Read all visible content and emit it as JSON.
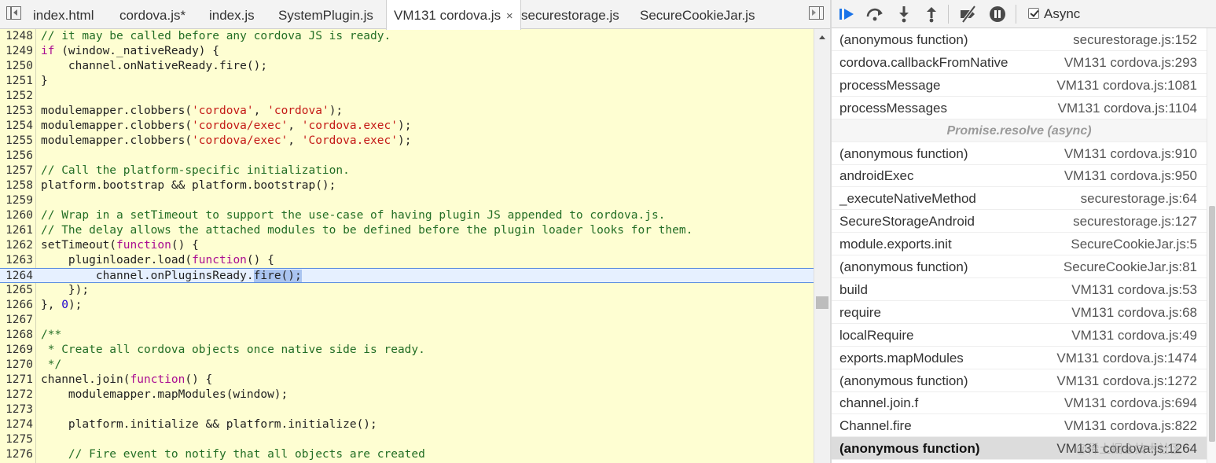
{
  "tabs": [
    {
      "label": "index.html",
      "active": false
    },
    {
      "label": "cordova.js*",
      "active": false
    },
    {
      "label": "index.js",
      "active": false
    },
    {
      "label": "SystemPlugin.js",
      "active": false
    },
    {
      "label": "VM131 cordova.js",
      "active": true,
      "close": "×"
    },
    {
      "label": "securestorage.js",
      "active": false
    },
    {
      "label": "SecureCookieJar.js",
      "active": false
    }
  ],
  "icons": {
    "toggle_navigator": "toggle-navigator-icon",
    "toggle_debugger": "toggle-debugger-icon"
  },
  "code": {
    "execution_line": "1264",
    "lines": [
      {
        "num": "1248",
        "tokens": [
          {
            "t": "// it may be called before any cordova JS is ready.",
            "c": "c"
          }
        ]
      },
      {
        "num": "1249",
        "tokens": [
          {
            "t": "if",
            "c": "k"
          },
          {
            "t": " (window._nativeReady) {"
          }
        ]
      },
      {
        "num": "1250",
        "tokens": [
          {
            "t": "    channel.onNativeReady.fire();"
          }
        ]
      },
      {
        "num": "1251",
        "tokens": [
          {
            "t": "}"
          }
        ]
      },
      {
        "num": "1252",
        "tokens": []
      },
      {
        "num": "1253",
        "tokens": [
          {
            "t": "modulemapper.clobbers("
          },
          {
            "t": "'cordova'",
            "c": "s"
          },
          {
            "t": ", "
          },
          {
            "t": "'cordova'",
            "c": "s"
          },
          {
            "t": ");"
          }
        ]
      },
      {
        "num": "1254",
        "tokens": [
          {
            "t": "modulemapper.clobbers("
          },
          {
            "t": "'cordova/exec'",
            "c": "s"
          },
          {
            "t": ", "
          },
          {
            "t": "'cordova.exec'",
            "c": "s"
          },
          {
            "t": ");"
          }
        ]
      },
      {
        "num": "1255",
        "tokens": [
          {
            "t": "modulemapper.clobbers("
          },
          {
            "t": "'cordova/exec'",
            "c": "s"
          },
          {
            "t": ", "
          },
          {
            "t": "'Cordova.exec'",
            "c": "s"
          },
          {
            "t": ");"
          }
        ]
      },
      {
        "num": "1256",
        "tokens": []
      },
      {
        "num": "1257",
        "tokens": [
          {
            "t": "// Call the platform-specific initialization.",
            "c": "c"
          }
        ]
      },
      {
        "num": "1258",
        "tokens": [
          {
            "t": "platform.bootstrap && platform.bootstrap();"
          }
        ]
      },
      {
        "num": "1259",
        "tokens": []
      },
      {
        "num": "1260",
        "tokens": [
          {
            "t": "// Wrap in a setTimeout to support the use-case of having plugin JS appended to cordova.js.",
            "c": "c"
          }
        ]
      },
      {
        "num": "1261",
        "tokens": [
          {
            "t": "// The delay allows the attached modules to be defined before the plugin loader looks for them.",
            "c": "c"
          }
        ]
      },
      {
        "num": "1262",
        "tokens": [
          {
            "t": "setTimeout("
          },
          {
            "t": "function",
            "c": "k"
          },
          {
            "t": "() {"
          }
        ]
      },
      {
        "num": "1263",
        "tokens": [
          {
            "t": "    pluginloader.load("
          },
          {
            "t": "function",
            "c": "k"
          },
          {
            "t": "() {"
          }
        ]
      },
      {
        "num": "1264",
        "tokens": [
          {
            "t": "        channel.onPluginsReady."
          },
          {
            "t": "fire();",
            "c": "sel"
          }
        ]
      },
      {
        "num": "1265",
        "tokens": [
          {
            "t": "    });"
          }
        ]
      },
      {
        "num": "1266",
        "tokens": [
          {
            "t": "}, "
          },
          {
            "t": "0",
            "c": "n"
          },
          {
            "t": ");"
          }
        ]
      },
      {
        "num": "1267",
        "tokens": []
      },
      {
        "num": "1268",
        "tokens": [
          {
            "t": "/**",
            "c": "c"
          }
        ]
      },
      {
        "num": "1269",
        "tokens": [
          {
            "t": " * Create all cordova objects once native side is ready.",
            "c": "c"
          }
        ]
      },
      {
        "num": "1270",
        "tokens": [
          {
            "t": " */",
            "c": "c"
          }
        ]
      },
      {
        "num": "1271",
        "tokens": [
          {
            "t": "channel.join("
          },
          {
            "t": "function",
            "c": "k"
          },
          {
            "t": "() {"
          }
        ]
      },
      {
        "num": "1272",
        "tokens": [
          {
            "t": "    modulemapper.mapModules(window);"
          }
        ]
      },
      {
        "num": "1273",
        "tokens": []
      },
      {
        "num": "1274",
        "tokens": [
          {
            "t": "    platform.initialize && platform.initialize();"
          }
        ]
      },
      {
        "num": "1275",
        "tokens": []
      },
      {
        "num": "1276",
        "tokens": [
          {
            "t": "    // Fire event to notify that all objects are created",
            "c": "c"
          }
        ]
      }
    ]
  },
  "toolbar": {
    "resume": "resume-icon",
    "step_over": "step-over-icon",
    "step_into": "step-into-icon",
    "step_out": "step-out-icon",
    "deactivate_breakpoints": "deactivate-breakpoints-icon",
    "pause_on_exceptions": "pause-on-exceptions-icon",
    "async_label": "Async",
    "async_checked": true
  },
  "call_stack": [
    {
      "fn": "(anonymous function)",
      "loc": "securestorage.js:152"
    },
    {
      "fn": "cordova.callbackFromNative",
      "loc": "VM131 cordova.js:293"
    },
    {
      "fn": "processMessage",
      "loc": "VM131 cordova.js:1081"
    },
    {
      "fn": "processMessages",
      "loc": "VM131 cordova.js:1104"
    },
    {
      "fn": "Promise.resolve (async)",
      "loc": "",
      "async": true
    },
    {
      "fn": "(anonymous function)",
      "loc": "VM131 cordova.js:910"
    },
    {
      "fn": "androidExec",
      "loc": "VM131 cordova.js:950"
    },
    {
      "fn": "_executeNativeMethod",
      "loc": "securestorage.js:64"
    },
    {
      "fn": "SecureStorageAndroid",
      "loc": "securestorage.js:127"
    },
    {
      "fn": "module.exports.init",
      "loc": "SecureCookieJar.js:5"
    },
    {
      "fn": "(anonymous function)",
      "loc": "SecureCookieJar.js:81"
    },
    {
      "fn": "build",
      "loc": "VM131 cordova.js:53"
    },
    {
      "fn": "require",
      "loc": "VM131 cordova.js:68"
    },
    {
      "fn": "localRequire",
      "loc": "VM131 cordova.js:49"
    },
    {
      "fn": "exports.mapModules",
      "loc": "VM131 cordova.js:1474"
    },
    {
      "fn": "(anonymous function)",
      "loc": "VM131 cordova.js:1272"
    },
    {
      "fn": "channel.join.f",
      "loc": "VM131 cordova.js:694"
    },
    {
      "fn": "Channel.fire",
      "loc": "VM131 cordova.js:822"
    },
    {
      "fn": "(anonymous function)",
      "loc": "VM131 cordova.js:1264",
      "selected": true
    }
  ],
  "watermark": "@稀土掘金技术社区",
  "colors": {
    "editor_bg": "#fefed2",
    "comment": "#236e25",
    "string": "#c41a16",
    "keyword": "#aa0d91",
    "number": "#1c00cf",
    "exec_line": "#e6f0ff",
    "accent_blue": "#1a73e8"
  }
}
